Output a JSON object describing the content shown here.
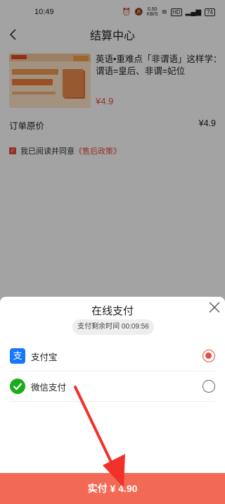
{
  "status_bar": {
    "time": "10:49",
    "net_speed": "0.50",
    "net_unit": "KB/S",
    "hd": "HD",
    "battery": "74"
  },
  "nav": {
    "title": "结算中心"
  },
  "product": {
    "name": "英语•重难点「非谓语」这样学：谓语=皇后、非谓=妃位",
    "price": "¥4.9"
  },
  "order": {
    "original_price_label": "订单原价",
    "original_price_value": "¥4.9"
  },
  "agreement": {
    "text": "我已阅读并同意",
    "policy_link": "《售后政策》"
  },
  "payment_sheet": {
    "title": "在线支付",
    "timer_label": "支付剩余时间",
    "timer_value": "00:09:56",
    "methods": [
      {
        "label": "支付宝",
        "selected": true
      },
      {
        "label": "微信支付",
        "selected": false
      }
    ]
  },
  "pay_button": {
    "label": "实付 ¥ 4.90"
  },
  "colors": {
    "accent": "#e94d3c",
    "pay_button": "#f26a56",
    "alipay": "#1677ff",
    "wechat": "#1aad19"
  }
}
